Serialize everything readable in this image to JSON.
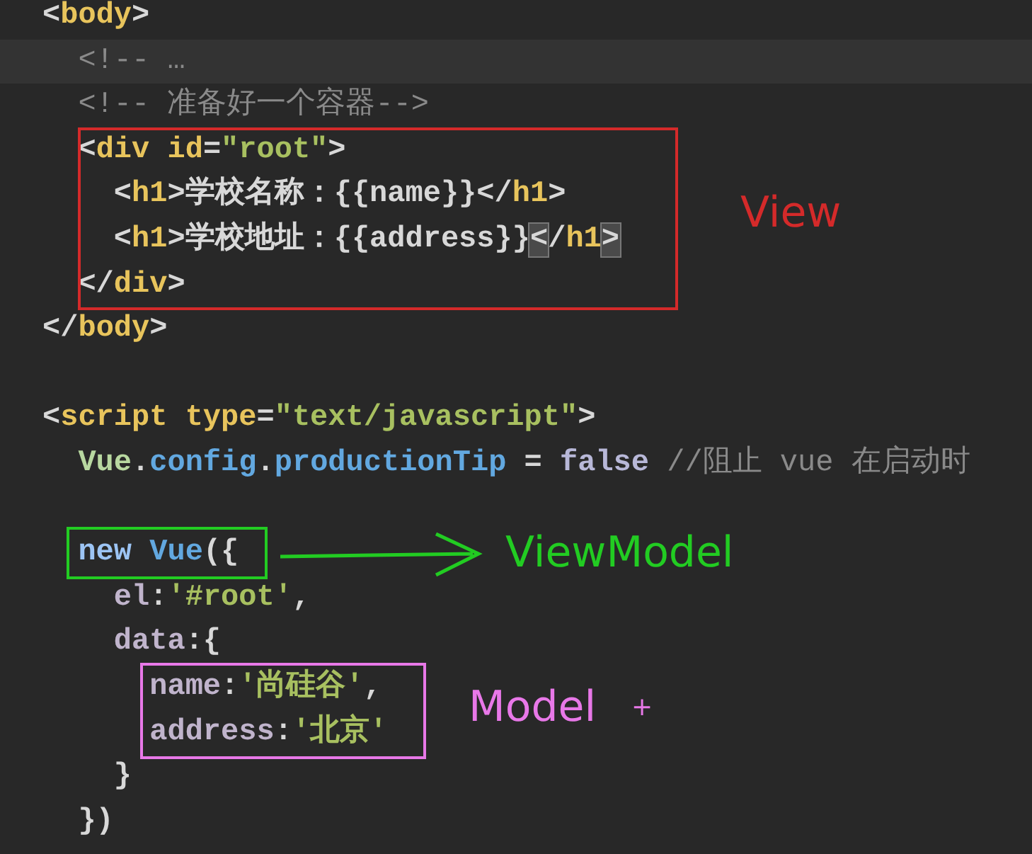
{
  "code_lines": [
    {
      "kind": "code",
      "highlighted": false,
      "tokens": [
        {
          "kind": "punct",
          "text": "<"
        },
        {
          "kind": "tag",
          "text": "body"
        },
        {
          "kind": "punct",
          "text": ">"
        }
      ]
    },
    {
      "kind": "code",
      "highlighted": true,
      "tokens": [
        {
          "kind": "comment",
          "text": "  <!-- …"
        }
      ]
    },
    {
      "kind": "code",
      "highlighted": false,
      "tokens": [
        {
          "kind": "comment",
          "text": "  <!-- 准备好一个容器-->"
        }
      ]
    },
    {
      "kind": "code",
      "highlighted": false,
      "tokens": [
        {
          "kind": "punct",
          "text": "  <"
        },
        {
          "kind": "tag",
          "text": "div id"
        },
        {
          "kind": "punct",
          "text": "="
        },
        {
          "kind": "string",
          "text": "\"root\""
        },
        {
          "kind": "punct",
          "text": ">"
        }
      ]
    },
    {
      "kind": "code",
      "highlighted": false,
      "tokens": [
        {
          "kind": "punct",
          "text": "    <"
        },
        {
          "kind": "tag",
          "text": "h1"
        },
        {
          "kind": "punct",
          "text": ">"
        },
        {
          "kind": "text",
          "text": "学校名称：{{name}}"
        },
        {
          "kind": "punct",
          "text": "</"
        },
        {
          "kind": "tag",
          "text": "h1"
        },
        {
          "kind": "punct",
          "text": ">"
        }
      ]
    },
    {
      "kind": "code",
      "highlighted": false,
      "tokens": [
        {
          "kind": "punct",
          "text": "    <"
        },
        {
          "kind": "tag",
          "text": "h1"
        },
        {
          "kind": "punct",
          "text": ">"
        },
        {
          "kind": "text",
          "text": "学校地址：{{address}}"
        },
        {
          "kind": "match",
          "text": "<"
        },
        {
          "kind": "punct",
          "text": "/"
        },
        {
          "kind": "tag",
          "text": "h1"
        },
        {
          "kind": "match",
          "text": ">"
        }
      ]
    },
    {
      "kind": "code",
      "highlighted": false,
      "tokens": [
        {
          "kind": "punct",
          "text": "  </"
        },
        {
          "kind": "tag",
          "text": "div"
        },
        {
          "kind": "punct",
          "text": ">"
        }
      ]
    },
    {
      "kind": "code",
      "highlighted": false,
      "tokens": [
        {
          "kind": "punct",
          "text": "</"
        },
        {
          "kind": "tag",
          "text": "body"
        },
        {
          "kind": "punct",
          "text": ">"
        }
      ]
    },
    {
      "kind": "blank"
    },
    {
      "kind": "code",
      "highlighted": false,
      "tokens": [
        {
          "kind": "punct",
          "text": "<"
        },
        {
          "kind": "tag",
          "text": "script type"
        },
        {
          "kind": "punct",
          "text": "="
        },
        {
          "kind": "string",
          "text": "\"text/javascript\""
        },
        {
          "kind": "punct",
          "text": ">"
        }
      ]
    },
    {
      "kind": "code",
      "highlighted": false,
      "tokens": [
        {
          "kind": "ident",
          "text": "  Vue"
        },
        {
          "kind": "punct",
          "text": "."
        },
        {
          "kind": "prop",
          "text": "config"
        },
        {
          "kind": "punct",
          "text": "."
        },
        {
          "kind": "prop",
          "text": "productionTip"
        },
        {
          "kind": "punct",
          "text": " = "
        },
        {
          "kind": "bool",
          "text": "false"
        },
        {
          "kind": "comment",
          "text": " //阻止 vue 在启动时"
        }
      ]
    },
    {
      "kind": "blank"
    },
    {
      "kind": "code",
      "highlighted": false,
      "tokens": [
        {
          "kind": "keyword",
          "text": "  new"
        },
        {
          "kind": "prop",
          "text": " Vue"
        },
        {
          "kind": "punct",
          "text": "({"
        }
      ]
    },
    {
      "kind": "code",
      "highlighted": false,
      "tokens": [
        {
          "kind": "key",
          "text": "    el"
        },
        {
          "kind": "punct",
          "text": ":"
        },
        {
          "kind": "string",
          "text": "'#root'"
        },
        {
          "kind": "punct",
          "text": ","
        }
      ]
    },
    {
      "kind": "code",
      "highlighted": false,
      "tokens": [
        {
          "kind": "key",
          "text": "    data"
        },
        {
          "kind": "punct",
          "text": ":{"
        }
      ]
    },
    {
      "kind": "code",
      "highlighted": false,
      "tokens": [
        {
          "kind": "key",
          "text": "      name"
        },
        {
          "kind": "punct",
          "text": ":"
        },
        {
          "kind": "string",
          "text": "'尚硅谷'"
        },
        {
          "kind": "punct",
          "text": ","
        }
      ]
    },
    {
      "kind": "code",
      "highlighted": false,
      "tokens": [
        {
          "kind": "key",
          "text": "      address"
        },
        {
          "kind": "punct",
          "text": ":"
        },
        {
          "kind": "string",
          "text": "'北京'"
        }
      ]
    },
    {
      "kind": "code",
      "highlighted": false,
      "tokens": [
        {
          "kind": "punct",
          "text": "    }"
        }
      ]
    },
    {
      "kind": "code",
      "highlighted": false,
      "tokens": [
        {
          "kind": "punct",
          "text": "  })"
        }
      ]
    }
  ],
  "annotations": [
    {
      "label": "View",
      "color": "#d42a2a",
      "arrow": false
    },
    {
      "label": "ViewModel",
      "color": "#22cc22",
      "arrow": true
    },
    {
      "label": "Model",
      "color": "#e878e8",
      "arrow": false,
      "mark": "+"
    }
  ]
}
